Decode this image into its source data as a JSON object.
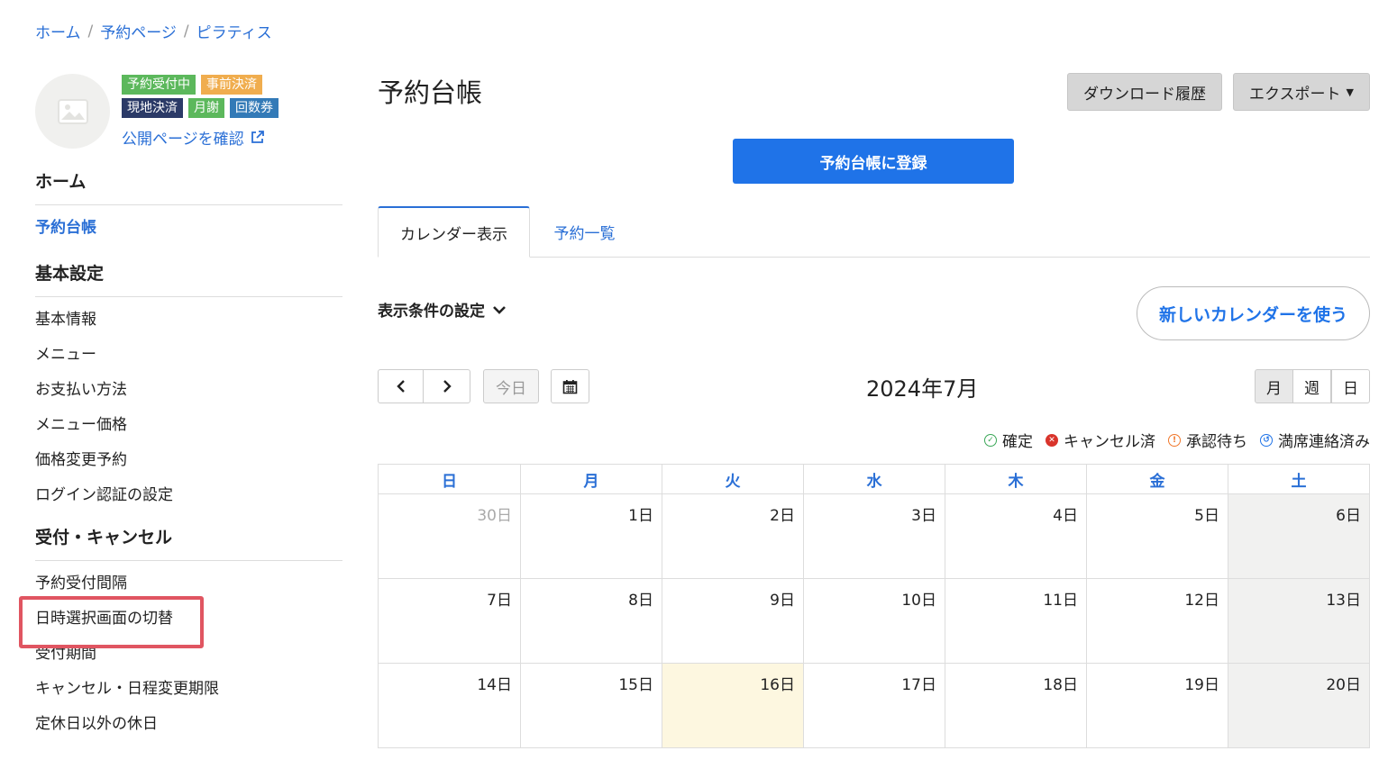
{
  "breadcrumb": [
    "ホーム",
    "予約ページ",
    "ピラティス"
  ],
  "badges": {
    "row1": [
      "予約受付中",
      "事前決済"
    ],
    "row2": [
      "現地決済",
      "月謝",
      "回数券"
    ]
  },
  "public_link": "公開ページを確認",
  "nav": {
    "home": "ホーム",
    "reservation_book": "予約台帳",
    "basic_settings": "基本設定",
    "basic_items": [
      "基本情報",
      "メニュー",
      "お支払い方法",
      "メニュー価格",
      "価格変更予約",
      "ログイン認証の設定"
    ],
    "reception": "受付・キャンセル",
    "reception_items": [
      "予約受付間隔",
      "日時選択画面の切替",
      "受付期間",
      "キャンセル・日程変更期限",
      "定休日以外の休日"
    ]
  },
  "main": {
    "title": "予約台帳",
    "download_history": "ダウンロード履歴",
    "export": "エクスポート",
    "register": "予約台帳に登録",
    "tabs": [
      "カレンダー表示",
      "予約一覧"
    ],
    "display_conditions": "表示条件の設定",
    "new_calendar": "新しいカレンダーを使う",
    "today": "今日",
    "month_title": "2024年7月",
    "views": [
      "月",
      "週",
      "日"
    ],
    "legend": [
      "確定",
      "キャンセル済",
      "承認待ち",
      "満席連絡済み"
    ]
  },
  "calendar": {
    "weekdays": [
      "日",
      "月",
      "火",
      "水",
      "木",
      "金",
      "土"
    ],
    "weeks": [
      [
        "30日",
        "1日",
        "2日",
        "3日",
        "4日",
        "5日",
        "6日"
      ],
      [
        "7日",
        "8日",
        "9日",
        "10日",
        "11日",
        "12日",
        "13日"
      ],
      [
        "14日",
        "15日",
        "16日",
        "17日",
        "18日",
        "19日",
        "20日"
      ]
    ],
    "today": "16日"
  }
}
